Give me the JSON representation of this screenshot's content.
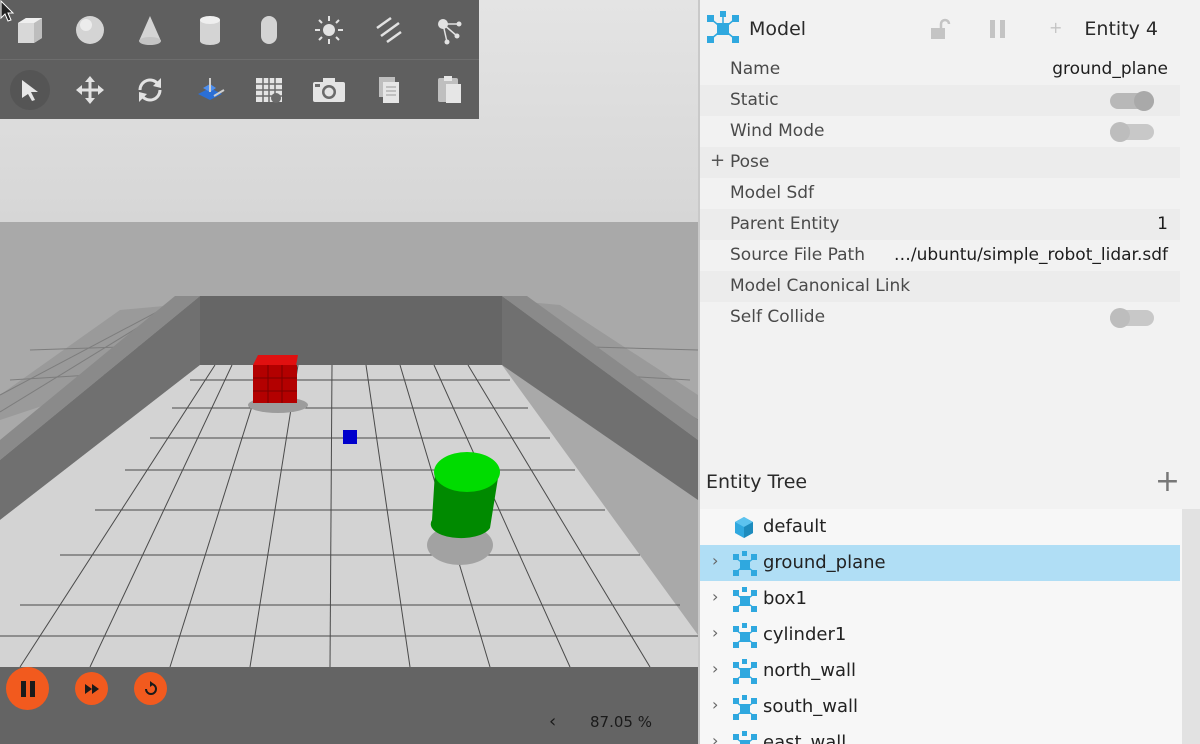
{
  "toolbar": {
    "row1": [
      "box-tool",
      "sphere-tool",
      "cone-tool",
      "cylinder-tool",
      "capsule-tool",
      "point-light-tool",
      "directional-light-tool",
      "spot-light-tool"
    ],
    "row2": [
      "select-tool",
      "translate-tool",
      "rotate-tool",
      "transform-control-tool",
      "grid-snap-tool",
      "screenshot-tool",
      "copy-tool",
      "paste-tool"
    ]
  },
  "playback": {
    "pause_label": "Pause",
    "step_label": "Step",
    "reset_label": "Reset",
    "rtf_chevron": "‹",
    "rtf": "87.05 %"
  },
  "inspector": {
    "title": "Model",
    "entity": "Entity 4",
    "add_label": "+",
    "properties": [
      {
        "label": "Name",
        "value": "ground_plane"
      },
      {
        "label": "Static",
        "toggle": true
      },
      {
        "label": "Wind Mode",
        "toggle": false
      },
      {
        "label": "Pose",
        "expandable": "+"
      },
      {
        "label": "Model Sdf",
        "value": ""
      },
      {
        "label": "Parent Entity",
        "value": "1"
      },
      {
        "label": "Source File Path",
        "value": "…/ubuntu/simple_robot_lidar.sdf"
      },
      {
        "label": "Model Canonical Link",
        "value": ""
      },
      {
        "label": "Self Collide",
        "toggle": false
      }
    ]
  },
  "entity_tree": {
    "title": "Entity Tree",
    "add_label": "+",
    "items": [
      {
        "label": "default",
        "chevron": "",
        "selected": false
      },
      {
        "label": "ground_plane",
        "chevron": "›",
        "selected": true
      },
      {
        "label": "box1",
        "chevron": "›",
        "selected": false
      },
      {
        "label": "cylinder1",
        "chevron": "›",
        "selected": false
      },
      {
        "label": "north_wall",
        "chevron": "›",
        "selected": false
      },
      {
        "label": "south_wall",
        "chevron": "›",
        "selected": false
      },
      {
        "label": "east_wall",
        "chevron": "›",
        "selected": false
      }
    ]
  },
  "colors": {
    "accent": "#f25a1e",
    "selection": "#b0def5",
    "entity_icon": "#2fa8df",
    "box": "#c00000",
    "cylinder": "#00c800",
    "robot": "#0000c8"
  }
}
